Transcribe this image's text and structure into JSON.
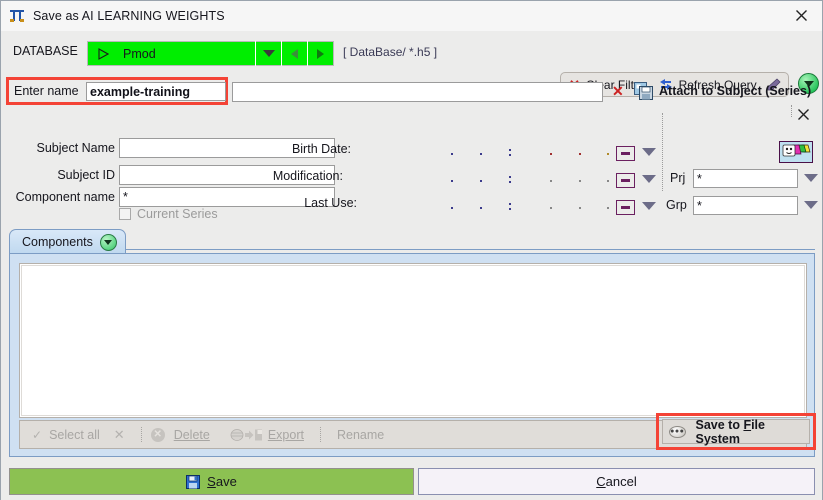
{
  "window": {
    "title": "Save as AI LEARNING WEIGHTS",
    "title_icon": "pmod-logo-icon",
    "close_icon": "close-icon"
  },
  "database_row": {
    "label": "DATABASE",
    "combo_value": "Pmod",
    "combo_play_icon": "play-icon",
    "combo_dropdown_icon": "chevron-down-icon",
    "prev_icon": "arrow-left-icon",
    "next_icon": "arrow-right-icon",
    "path": "[ DataBase/ *.h5 ]",
    "clear_filter_label": "Clear Filter",
    "clear_filter_icon": "x-red-icon",
    "refresh_query_label": "Refresh Query",
    "refresh_query_icon": "refresh-icon",
    "edit_query_icon": "pen-icon",
    "options_icon": "green-dropdown-icon",
    "combo_color": "#00ee00"
  },
  "name_row": {
    "label": "Enter name",
    "value": "example-training",
    "placeholder": "",
    "second_value": "",
    "second_placeholder": "",
    "clear_icon": "x-red-icon",
    "attach_icon": "attach-save-icon",
    "attach_label": "Attach to Subject (Series)",
    "close_icon": "close-icon",
    "highlight_color": "#f44336"
  },
  "form": {
    "subject_name_label": "Subject Name",
    "subject_name_value": "",
    "subject_id_label": "Subject ID",
    "subject_id_value": "",
    "component_name_label": "Component name",
    "component_name_value": "*",
    "current_series_label": "Current Series",
    "current_series_checked": false,
    "birth_date_label": "Birth Date:",
    "birth_date_value": "",
    "modification_label": "Modification:",
    "modification_value": "",
    "last_use_label": "Last Use:",
    "last_use_value": "",
    "date_button_icon": "date-field-icon",
    "date_caret_icon": "chevron-down-icon",
    "series_icon": "series-cards-icon",
    "prj_label": "Prj",
    "prj_value": "*",
    "prj_caret_icon": "chevron-down-icon",
    "grp_label": "Grp",
    "grp_value": "*",
    "grp_caret_icon": "chevron-down-icon"
  },
  "tabs": {
    "active": "Components",
    "dropdown_icon": "green-dropdown-icon"
  },
  "list": {
    "items": [],
    "toolbar": {
      "select_all_label": "Select all",
      "select_all_icon": "check-icon",
      "deselect_icon": "x-icon",
      "delete_label": "Delete",
      "delete_icon": "delete-circle-icon",
      "export_label": "Export",
      "export_icon": "export-disk-icon",
      "rename_label": "Rename"
    }
  },
  "save_to_file_system": {
    "label": "Save to File System",
    "icon": "ellipsis-button-icon",
    "highlight_color": "#f44336"
  },
  "footer": {
    "save_label": "Save",
    "save_icon": "floppy-disk-icon",
    "save_color": "#8cc152",
    "cancel_label": "Cancel"
  }
}
